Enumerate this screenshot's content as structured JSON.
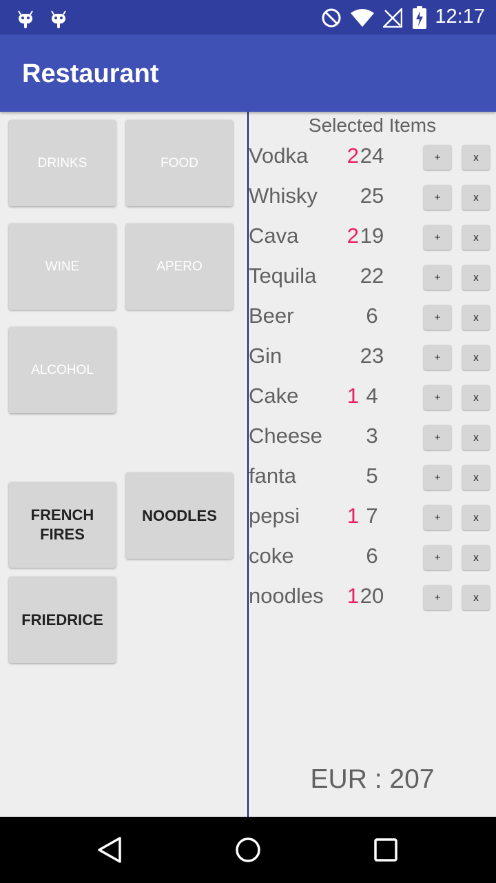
{
  "status_bar": {
    "time": "12:17",
    "icons": [
      "android-icon",
      "android-icon",
      "do-not-disturb-icon",
      "wifi-icon",
      "no-signal-icon",
      "battery-charging-icon"
    ]
  },
  "app_bar": {
    "title": "Restaurant"
  },
  "categories": {
    "drinks": "DRINKS",
    "food": "FOOD",
    "wine": "WINE",
    "apero": "APERO",
    "alcohol": "ALCOHOL"
  },
  "products": {
    "french_fires": "FRENCH FIRES",
    "noodles": "NOODLES",
    "friedrice": "FRIEDRICE"
  },
  "selected": {
    "header": "Selected Items",
    "plus_label": "+",
    "remove_label": "x",
    "items": [
      {
        "name": "Vodka",
        "qty": "2",
        "price": "24"
      },
      {
        "name": "Whisky",
        "qty": "",
        "price": "25"
      },
      {
        "name": "Cava",
        "qty": "2",
        "price": "19"
      },
      {
        "name": "Tequila",
        "qty": "",
        "price": "22"
      },
      {
        "name": "Beer",
        "qty": "",
        "price": "6"
      },
      {
        "name": "Gin",
        "qty": "",
        "price": "23"
      },
      {
        "name": "Cake",
        "qty": "1",
        "price": "4"
      },
      {
        "name": "Cheese",
        "qty": "",
        "price": "3"
      },
      {
        "name": "fanta",
        "qty": "",
        "price": "5"
      },
      {
        "name": "pepsi",
        "qty": "1",
        "price": "7"
      },
      {
        "name": "coke",
        "qty": "",
        "price": "6"
      },
      {
        "name": "noodles",
        "qty": "1",
        "price": "20"
      }
    ]
  },
  "total": "EUR : 207",
  "colors": {
    "status_bar": "#303f9f",
    "app_bar": "#3f51b5",
    "quantity": "#e91e63",
    "divider": "#1a237e"
  }
}
